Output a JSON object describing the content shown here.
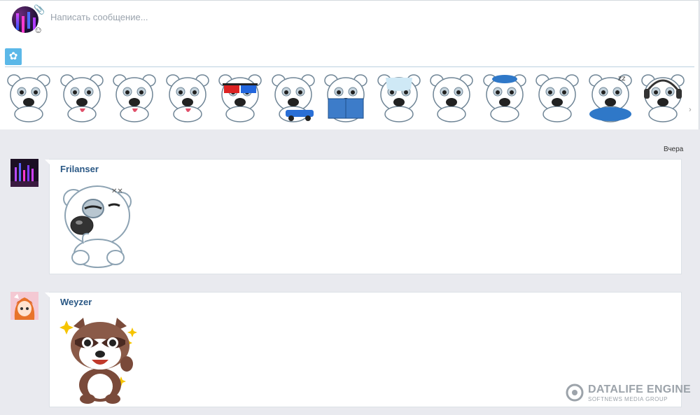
{
  "composer": {
    "placeholder": "Написать сообщение...",
    "attach_icon": "paperclip-icon",
    "emoji_icon": "smiley-icon",
    "sticker_tab_icon": "paw-icon"
  },
  "sticker_pack": {
    "count_visible": 13,
    "stickers": [
      "worried",
      "wink-tongue",
      "sweat-tongue",
      "crying-tongue",
      "3d-glasses",
      "race-car",
      "reading-book",
      "frozen",
      "angry",
      "hiding-hat",
      "skeptical",
      "sleeping",
      "dj-headphones"
    ]
  },
  "feed": {
    "date_label": "Вчера",
    "messages": [
      {
        "author": "Frilanser",
        "sticker": "skeptical-thumb-bear"
      },
      {
        "author": "Weyzer",
        "sticker": "raccoon-waving-sparkles"
      }
    ]
  },
  "watermark": {
    "title": "DATALIFE ENGINE",
    "subtitle": "SOFTNEWS MEDIA GROUP"
  },
  "colors": {
    "link": "#2a5885",
    "accent": "#5bb8e8",
    "background": "#e9eaef"
  }
}
